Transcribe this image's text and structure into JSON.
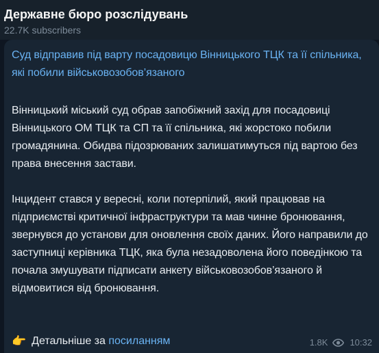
{
  "header": {
    "title": "Державне бюро розслідувань",
    "subscribers": "22.7K subscribers"
  },
  "post": {
    "headline": "Суд відправив під варту посадовицю Вінницького ТЦК та її спільника, які побили військовозобов’язаного",
    "paragraph1": "Вінницький міський суд обрав запобіжний захід для посадовиці Вінницького ОМ ТЦК та СП та її спільника, які жорстоко побили громадянина. Обидва підозрюваних залишатимуться під вартою без права внесення застави.",
    "paragraph2": "Інцидент стався у вересні, коли потерпілий, який працював на підприємстві критичної інфраструктури та мав чинне бронювання, звернувся до установи для оновлення своїх даних. Його направили до заступниці керівника ТЦК, яка була незадоволена його поведінкою та почала змушувати підписати анкету військовозобов’язаного й відмовитися від бронювання.",
    "footer_emoji": "👉",
    "footer_text": "Детальніше за",
    "footer_link": "посиланням",
    "views": "1.8K",
    "time": "10:32",
    "icons": {
      "pointing": "pointing-hand-icon",
      "views": "eye-icon"
    }
  },
  "colors": {
    "background": "#0e1621",
    "header": "#17212b",
    "bubble": "#182533",
    "link": "#6ab3f3",
    "text": "#e9edf1",
    "muted": "#7d8b99"
  }
}
